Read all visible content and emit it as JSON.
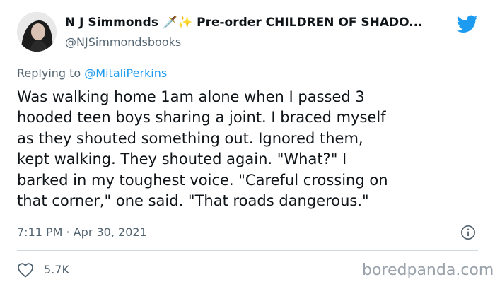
{
  "author": {
    "name": "N J Simmonds 🗡️✨ Pre-order CHILDREN OF SHADO...",
    "handle": "@NJSimmondsbooks"
  },
  "reply": {
    "prefix": "Replying to ",
    "mention": "@MitaliPerkins"
  },
  "tweet": {
    "lines": [
      "Was walking home 1am alone when I passed 3",
      "hooded teen boys sharing a joint. I braced myself",
      "as they shouted something out. Ignored them,",
      "kept walking. They shouted again. \"What?\" I",
      "barked in my toughest voice. \"Careful crossing on",
      "that corner,\" one said. \"That roads dangerous.\""
    ],
    "timestamp": "7:11 PM · Apr 30, 2021"
  },
  "engagement": {
    "likes": "5.7K"
  },
  "watermark": "boredpanda.com",
  "icons": {
    "brand": "twitter-bird-icon",
    "info": "info-icon",
    "like": "heart-icon"
  },
  "colors": {
    "twitter_blue": "#1d9bf0",
    "text": "#0f1419",
    "muted": "#536471",
    "divider": "#cfd9de",
    "watermark": "#9aa3ab"
  }
}
